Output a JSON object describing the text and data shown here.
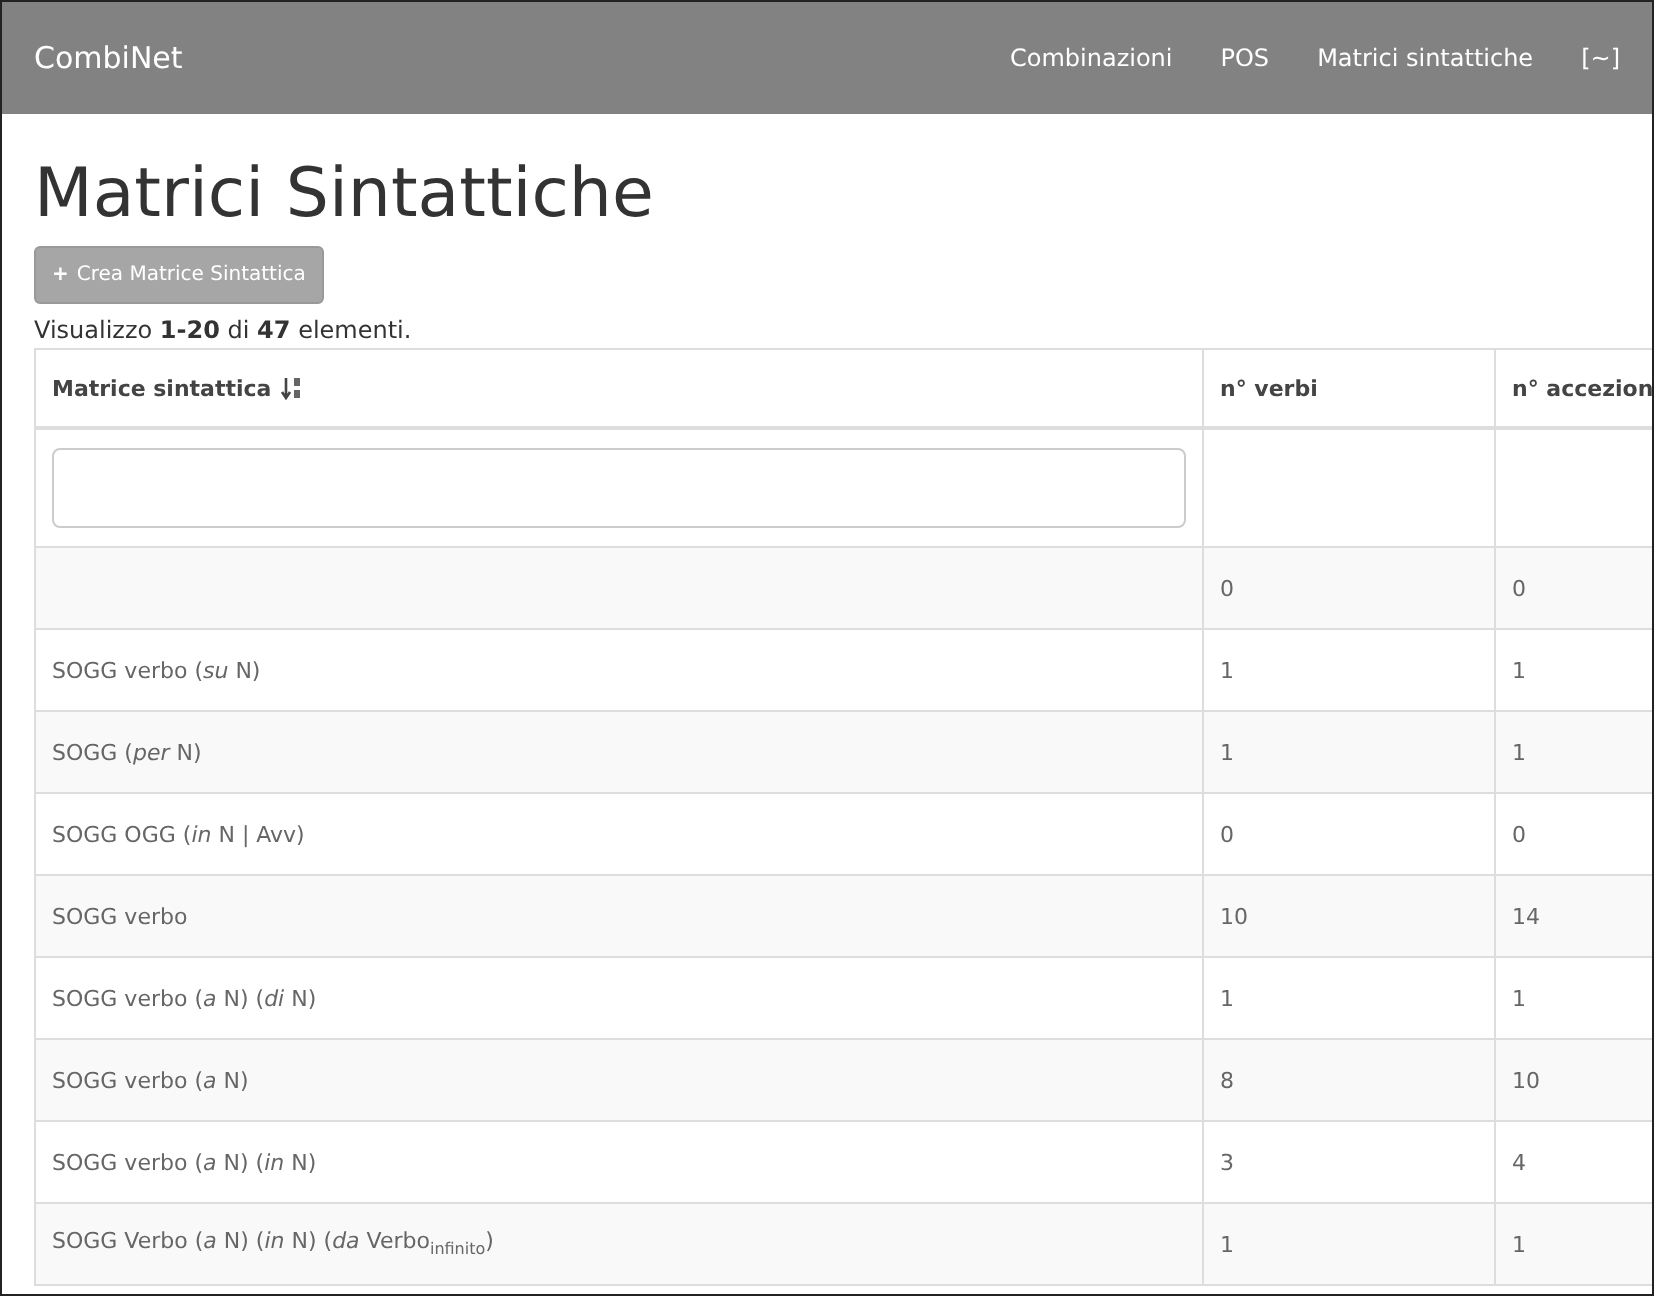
{
  "navbar": {
    "brand": "CombiNet",
    "links": [
      "Combinazioni",
      "POS",
      "Matrici sintattiche",
      "[~]"
    ]
  },
  "page_title": "Matrici Sintattiche",
  "create_button": {
    "icon": "+",
    "label": "Crea Matrice Sintattica"
  },
  "summary": "Visualizzo **1-20** di **47** elementi.",
  "table": {
    "columns": [
      {
        "label": "Matrice sintattica",
        "sortable": true
      },
      {
        "label": "n° verbi"
      },
      {
        "label": "n° accezion"
      }
    ],
    "rows": [
      [
        "",
        "0",
        "0"
      ],
      [
        "SOGG  verbo (*su* N)",
        "1",
        "1"
      ],
      [
        "SOGG (*per* N)",
        "1",
        "1"
      ],
      [
        "SOGG OGG (*in* N | Avv)",
        "0",
        "0"
      ],
      [
        "SOGG verbo",
        "10",
        "14"
      ],
      [
        "SOGG verbo (*a* N) (*di* N)",
        "1",
        "1"
      ],
      [
        "SOGG verbo (*a* N)",
        "8",
        "10"
      ],
      [
        "SOGG verbo (*a* N) (*in* N)",
        "3",
        "4"
      ],
      [
        "SOGG Verbo (*a* N) (*in* N) (*da* Verbo$_{infinito}$)",
        "1",
        "1"
      ]
    ]
  }
}
